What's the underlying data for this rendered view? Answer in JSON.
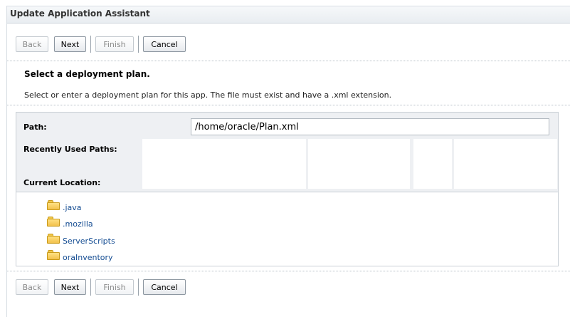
{
  "title": "Update Application Assistant",
  "buttons": {
    "back": "Back",
    "next": "Next",
    "finish": "Finish",
    "cancel": "Cancel"
  },
  "section": {
    "heading": "Select a deployment plan.",
    "instruction": "Select or enter a deployment plan for this app. The file must exist and have a .xml extension."
  },
  "form": {
    "path_label": "Path:",
    "path_value": "/home/oracle/Plan.xml",
    "recent_label": "Recently Used Paths:",
    "current_label": "Current Location:"
  },
  "folders": [
    ".java",
    ".mozilla",
    "ServerScripts",
    "oraInventory"
  ],
  "icons": {
    "folder": "folder-icon"
  },
  "colors": {
    "link": "#144c92",
    "folder": "#f2c14c",
    "panel_header": "#eef0f3"
  }
}
